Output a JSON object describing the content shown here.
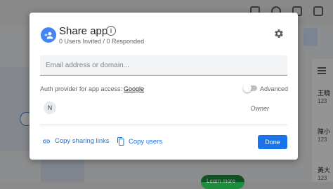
{
  "background": {
    "right_panel": [
      {
        "name": "王曉",
        "value": "123"
      },
      {
        "name": "陳小",
        "value": "123"
      },
      {
        "name": "黃大",
        "value": "123"
      }
    ],
    "partial_button_label": "Learn more"
  },
  "dialog": {
    "title": "Share app",
    "subtitle": "0 Users Invited / 0 Responded",
    "email_placeholder": "Email address or domain...",
    "auth_label": "Auth provider for app access:",
    "auth_provider": "Google",
    "advanced_label": "Advanced",
    "advanced_enabled": false,
    "user_initial": "N",
    "user_role": "Owner",
    "copy_links_label": "Copy sharing links",
    "copy_users_label": "Copy users",
    "done_label": "Done"
  },
  "colors": {
    "accent": "#1a73e8",
    "avatar_blue": "#4285f4"
  }
}
